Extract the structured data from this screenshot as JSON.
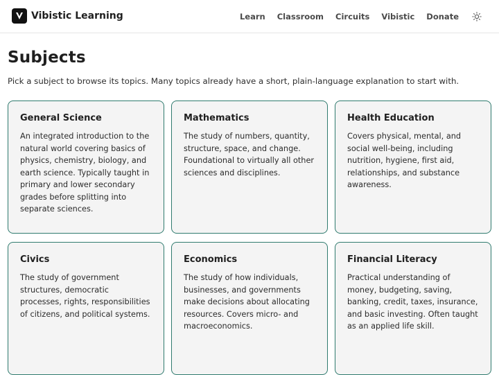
{
  "header": {
    "brand": "Vibistic Learning",
    "nav": [
      "Learn",
      "Classroom",
      "Circuits",
      "Vibistic",
      "Donate"
    ]
  },
  "page": {
    "title": "Subjects",
    "subtitle": "Pick a subject to browse its topics. Many topics already have a short, plain-language explanation to start with."
  },
  "subjects": [
    {
      "title": "General Science",
      "description": "An integrated introduction to the natural world covering basics of physics, chemistry, biology, and earth science. Typically taught in primary and lower secondary grades before splitting into separate sciences."
    },
    {
      "title": "Mathematics",
      "description": "The study of numbers, quantity, structure, space, and change. Foundational to virtually all other sciences and disciplines."
    },
    {
      "title": "Health Education",
      "description": "Covers physical, mental, and social well-being, including nutrition, hygiene, first aid, relationships, and substance awareness."
    },
    {
      "title": "Civics",
      "description": "The study of government structures, democratic processes, rights, responsibilities of citizens, and political systems."
    },
    {
      "title": "Economics",
      "description": "The study of how individuals, businesses, and governments make decisions about allocating resources. Covers micro- and macroeconomics."
    },
    {
      "title": "Financial Literacy",
      "description": "Practical understanding of money, budgeting, saving, banking, credit, taxes, insurance, and basic investing. Often taught as an applied life skill."
    }
  ],
  "colors": {
    "card_border": "#2f7a6e",
    "card_bg": "#f4f4f4"
  }
}
